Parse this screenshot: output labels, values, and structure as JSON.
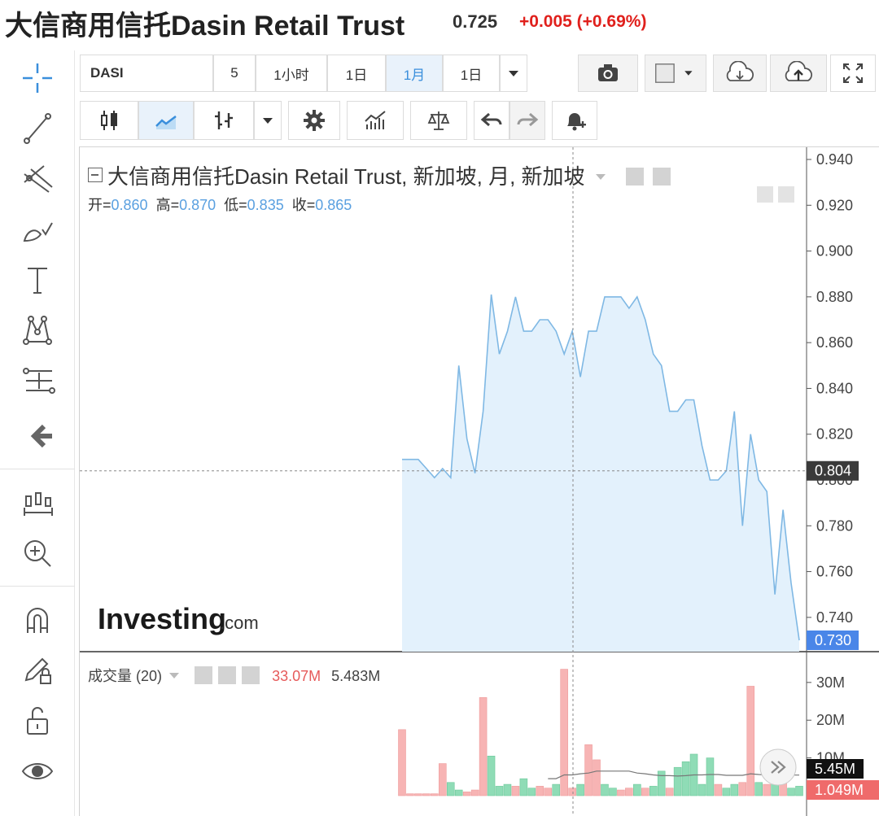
{
  "header": {
    "title": "大信商用信托Dasin Retail Trust",
    "last_price": "0.725",
    "change": "+0.005 (+0.69%)"
  },
  "toolbar": {
    "symbol": "DASI",
    "intervals": [
      "5",
      "1小时",
      "1日",
      "1月",
      "1日"
    ],
    "active_interval": "1月"
  },
  "legend": {
    "title": "大信商用信托Dasin Retail Trust, 新加坡, 月, 新加坡",
    "open_label": "开=",
    "open": "0.860",
    "high_label": "高=",
    "high": "0.870",
    "low_label": "低=",
    "low": "0.835",
    "close_label": "收=",
    "close": "0.865"
  },
  "volume_legend": {
    "label": "成交量 (20)",
    "value1": "33.07M",
    "value2": "5.483M"
  },
  "price_axis": {
    "ticks": [
      "0.940",
      "0.920",
      "0.900",
      "0.880",
      "0.860",
      "0.840",
      "0.820",
      "0.800",
      "0.780",
      "0.760",
      "0.740"
    ],
    "crosshair_label": "0.804",
    "last_label": "0.730"
  },
  "volume_axis": {
    "ticks": [
      "30M",
      "20M",
      "10M"
    ],
    "ma_label": "5.45M",
    "last_label": "1.049M"
  },
  "watermark": {
    "brand": "Investing",
    "suffix": ".com"
  },
  "colors": {
    "line": "#7fb8e4",
    "area": "#e3f1fc",
    "up_volume": "#8fdcb6",
    "down_volume": "#f7b4b4",
    "change_red": "#e0201c",
    "crosshair_box": "#3a3a3a",
    "last_box": "#4a86e8",
    "vol_last_box": "#ef6b6b"
  },
  "chart_data": {
    "type": "area",
    "price": [
      0.809,
      0.809,
      0.809,
      0.805,
      0.801,
      0.805,
      0.801,
      0.85,
      0.818,
      0.803,
      0.83,
      0.881,
      0.855,
      0.865,
      0.88,
      0.865,
      0.865,
      0.87,
      0.87,
      0.865,
      0.855,
      0.865,
      0.845,
      0.865,
      0.865,
      0.88,
      0.88,
      0.88,
      0.875,
      0.88,
      0.87,
      0.855,
      0.85,
      0.83,
      0.83,
      0.835,
      0.835,
      0.815,
      0.8,
      0.8,
      0.804,
      0.83,
      0.78,
      0.82,
      0.8,
      0.795,
      0.75,
      0.787,
      0.755,
      0.73
    ],
    "volume_M": [
      17.5,
      0.5,
      0.5,
      0.5,
      0.5,
      8.5,
      3.5,
      1.5,
      1.0,
      1.5,
      26,
      10.5,
      2.5,
      3.0,
      2.5,
      4.5,
      2.0,
      2.5,
      2.0,
      3.0,
      33.5,
      2.0,
      3.0,
      13.5,
      9.5,
      3.0,
      2.0,
      1.5,
      2.0,
      3.0,
      2.0,
      2.5,
      6.5,
      2.0,
      7.5,
      9.0,
      11.0,
      3.0,
      10.0,
      3.0,
      2.0,
      3.0,
      3.5,
      29,
      3.5,
      3.0,
      8.0,
      3.5,
      2.0,
      2.5
    ],
    "volume_up": [
      false,
      false,
      false,
      false,
      false,
      false,
      true,
      true,
      false,
      false,
      false,
      true,
      true,
      true,
      false,
      true,
      true,
      false,
      false,
      true,
      false,
      false,
      true,
      false,
      false,
      true,
      true,
      false,
      false,
      true,
      false,
      true,
      true,
      false,
      true,
      true,
      true,
      true,
      true,
      false,
      true,
      true,
      false,
      false,
      true,
      false,
      true,
      false,
      true,
      true
    ],
    "volume_ma_M": [
      null,
      null,
      null,
      null,
      null,
      null,
      null,
      null,
      null,
      null,
      null,
      null,
      null,
      null,
      null,
      null,
      null,
      null,
      4.5,
      4.5,
      5.5,
      5.5,
      5.8,
      6.0,
      6.5,
      6.5,
      6.5,
      6.5,
      6.5,
      6.0,
      5.8,
      5.5,
      5.3,
      5.3,
      5.2,
      5.3,
      5.5,
      5.5,
      5.6,
      5.6,
      5.4,
      5.4,
      5.4,
      5.8,
      5.6,
      5.5,
      5.5,
      5.5,
      5.45,
      5.45
    ],
    "ylim_price": [
      0.73,
      0.944
    ],
    "ylim_volume_M": [
      0,
      36
    ]
  }
}
